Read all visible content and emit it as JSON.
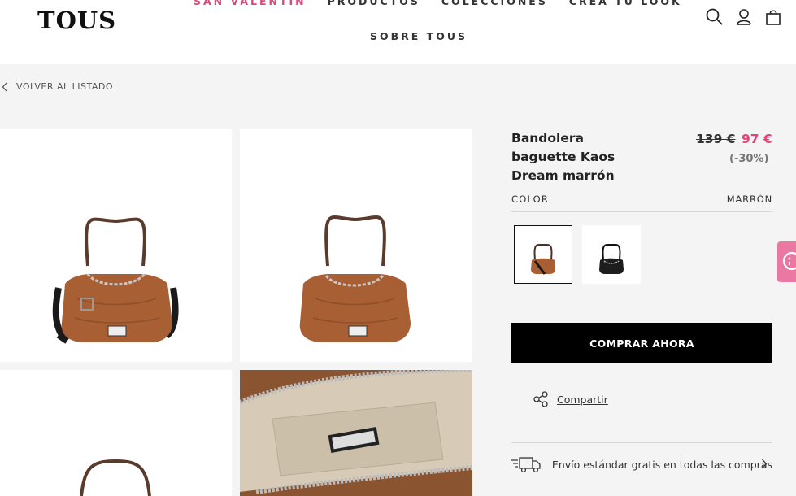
{
  "header": {
    "logo": "TOUS",
    "nav": [
      "SAN VALENTÍN",
      "PRODUCTOS",
      "COLECCIONES",
      "CREA TU LOOK"
    ],
    "nav_second_row": "SOBRE TOUS",
    "icons": [
      "search-icon",
      "user-icon",
      "bag-icon"
    ]
  },
  "breadcrumb": {
    "back_label": "VOLVER AL LISTADO"
  },
  "product": {
    "name": "Bandolera baguette Kaos Dream marrón",
    "price_old": "139 €",
    "price_new": "97 €",
    "discount": "(-30%)",
    "color_label": "COLOR",
    "color_value": "MARRÓN",
    "swatches": [
      "marrón",
      "negro"
    ],
    "buy_label": "COMPRAR AHORA",
    "share_label": "Compartir",
    "shipping_label": "Envío estándar gratis en todas las compras"
  },
  "colors": {
    "accent": "#e0457b",
    "button_bg": "#000000",
    "bag_brown": "#8b5431"
  }
}
